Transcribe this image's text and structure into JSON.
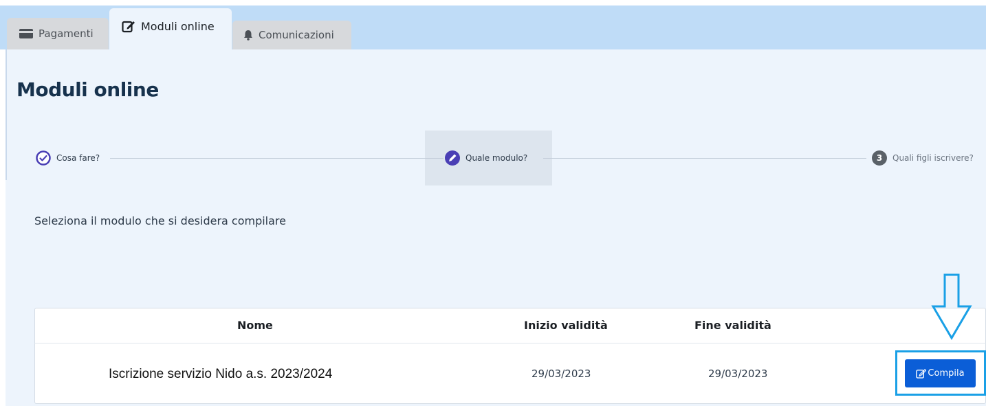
{
  "tabs": [
    {
      "label": "Pagamenti",
      "icon": "credit-card-icon"
    },
    {
      "label": "Moduli online",
      "icon": "edit-icon",
      "active": true
    },
    {
      "label": "Comunicazioni",
      "icon": "bell-icon"
    }
  ],
  "page_title": "Moduli online",
  "stepper": {
    "steps": [
      {
        "label": "Cosa fare?",
        "state": "done"
      },
      {
        "label": "Quale modulo?",
        "state": "active"
      },
      {
        "number": "3",
        "label": "Quali figli iscrivere?",
        "state": "pending"
      }
    ]
  },
  "instruction": "Seleziona il modulo che si desidera compilare",
  "table": {
    "headers": {
      "nome": "Nome",
      "inizio": "Inizio validità",
      "fine": "Fine validità"
    },
    "rows": [
      {
        "nome": "Iscrizione servizio Nido a.s. 2023/2024",
        "inizio": "29/03/2023",
        "fine": "29/03/2023",
        "action": "Compila"
      }
    ]
  },
  "colors": {
    "primary": "#0b5ed7",
    "title": "#17324d",
    "step_active": "#4a3fb5",
    "highlight": "#1aa0e6",
    "tabbar": "#bfdcf7",
    "panel": "#edf4fc"
  }
}
